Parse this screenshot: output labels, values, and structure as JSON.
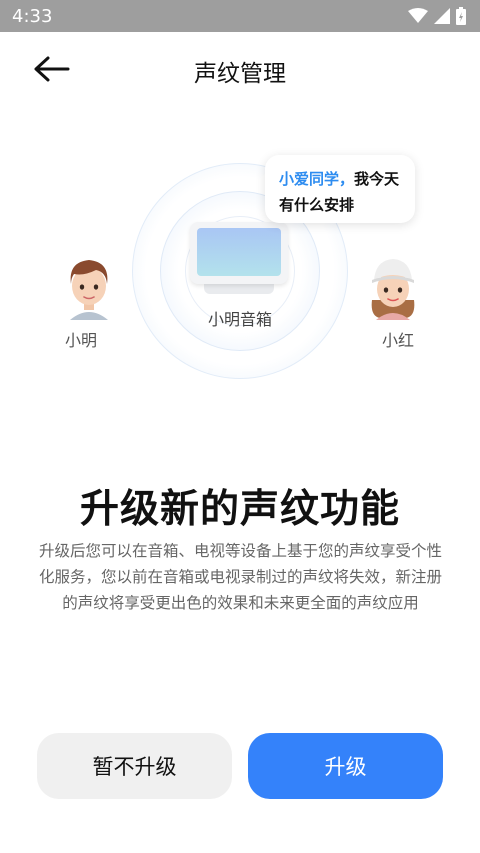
{
  "status_bar": {
    "time": "4:33"
  },
  "header": {
    "title": "声纹管理"
  },
  "illustration": {
    "speaker_label": "小明音箱",
    "bubble_highlight": "小爱同学，",
    "bubble_text_line1": "我今天",
    "bubble_text_line2": "有什么安排",
    "left_user_name": "小明",
    "right_user_name": "小红"
  },
  "main": {
    "heading": "升级新的声纹功能",
    "description": "升级后您可以在音箱、电视等设备上基于您的声纹享受个性化服务，您以前在音箱或电视录制过的声纹将失效，新注册的声纹将享受更出色的效果和未来更全面的声纹应用"
  },
  "buttons": {
    "secondary_label": "暂不升级",
    "primary_label": "升级"
  },
  "colors": {
    "accent": "#3482fa",
    "highlight": "#2d8cf0",
    "status_bar": "#9e9e9e"
  }
}
